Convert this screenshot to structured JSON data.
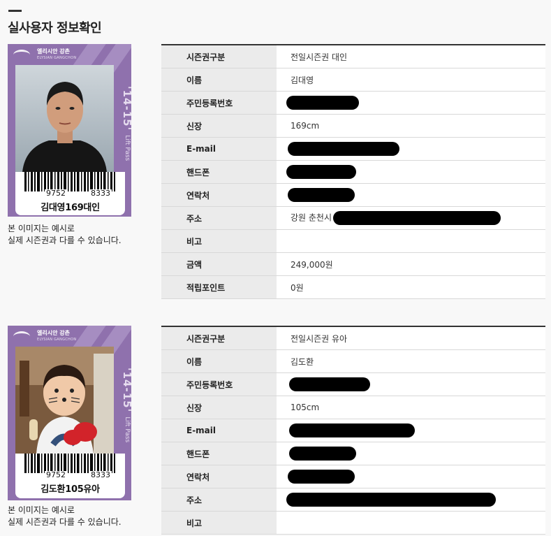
{
  "page": {
    "title": "실사용자 정보확인"
  },
  "card_brand": {
    "name_ko": "엘리시안 강촌",
    "name_en": "ELYSIAN GANGCHON",
    "season": "'14-15'",
    "pass": "Lift Pass"
  },
  "notice": {
    "line1": "본 이미지는 예시로",
    "line2": "실제 시즌권과 다를 수 있습니다."
  },
  "users": [
    {
      "barcode_left": "9752",
      "barcode_right": "8333",
      "holder": "김대영169대인",
      "fields": {
        "season_type": {
          "label": "시즌권구분",
          "value": "전일시즌권 대인"
        },
        "name": {
          "label": "이름",
          "value": "김대영"
        },
        "resident_no": {
          "label": "주민등록번호"
        },
        "height": {
          "label": "신장",
          "value": "169cm"
        },
        "email": {
          "label": "E-mail"
        },
        "phone": {
          "label": "핸드폰"
        },
        "contact": {
          "label": "연락처"
        },
        "address": {
          "label": "주소",
          "value": "강원 춘천시"
        },
        "remark": {
          "label": "비고",
          "value": ""
        },
        "amount": {
          "label": "금액",
          "value": "249,000원"
        },
        "points": {
          "label": "적립포인트",
          "value": "0원"
        }
      }
    },
    {
      "barcode_left": "9752",
      "barcode_right": "8333",
      "holder": "김도환105유아",
      "fields": {
        "season_type": {
          "label": "시즌권구분",
          "value": "전일시즌권 유아"
        },
        "name": {
          "label": "이름",
          "value": "김도환"
        },
        "resident_no": {
          "label": "주민등록번호"
        },
        "height": {
          "label": "신장",
          "value": "105cm"
        },
        "email": {
          "label": "E-mail"
        },
        "phone": {
          "label": "핸드폰"
        },
        "contact": {
          "label": "연락처"
        },
        "address": {
          "label": "주소"
        },
        "remark": {
          "label": "비고",
          "value": ""
        }
      }
    }
  ],
  "colors": {
    "card_purple": "#8f71ad",
    "label_bg": "#ebebeb",
    "redaction": "#000000"
  }
}
